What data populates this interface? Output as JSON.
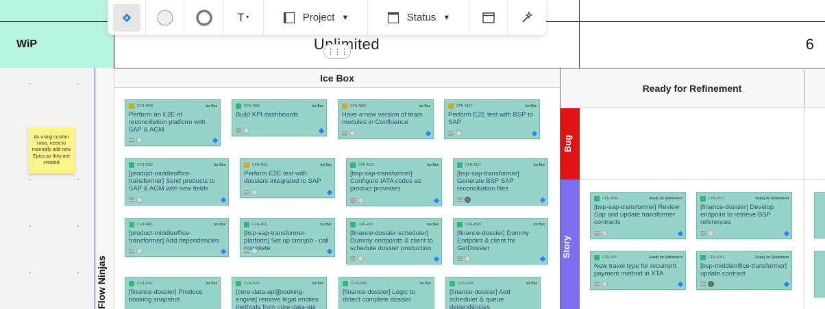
{
  "wip": {
    "label": "WiP",
    "value": "Unlimited",
    "value2": "6"
  },
  "toolbar": {
    "project_label": "Project",
    "status_label": "Status",
    "text_label": "T"
  },
  "sticky_note": "As using custom rows, need to manually add new Epics as they are created",
  "swimlane": {
    "name": "Flow Ninjas"
  },
  "icebox": {
    "title": "Ice Box",
    "cards": [
      {
        "key": "CFN-4946",
        "status": "Ice Box",
        "type": "task",
        "title": "Perform an E2E of reconciliation platform with SAP & AGM",
        "avatar": "empty"
      },
      {
        "key": "CFN-4289",
        "status": "Ice Box",
        "type": "story",
        "title": "Build KPI dashboards",
        "avatar": "empty"
      },
      {
        "key": "CFN-4806",
        "status": "Ice Box",
        "type": "task",
        "title": "Have a new version of team modules in Confluence",
        "avatar": "empty"
      },
      {
        "key": "CFN-4527",
        "status": "Ice Box",
        "type": "task",
        "title": "Perform E2E test with BSP to SAP",
        "avatar": "empty"
      },
      {
        "key": "CFN-4352",
        "status": "Ice Box",
        "type": "story",
        "title": "[product-middleoffice-transformer] Send products to SAP & AGM with new fields",
        "avatar": "empty"
      },
      {
        "key": "CFN-4561",
        "status": "Ice Box",
        "type": "task",
        "title": "Perform E2E test with dossiers integrated to SAP",
        "avatar": "empty"
      },
      {
        "key": "CFN-4319",
        "status": "Ice Box",
        "type": "story",
        "title": "[bsp-sap-transformer] Configure IATA codes as product providers",
        "avatar": "empty"
      },
      {
        "key": "CFN-4517",
        "status": "Ice Box",
        "type": "story",
        "title": "[bsp-sap-transformer] Generate BSP SAP reconciliation files",
        "avatar": "dark"
      },
      {
        "key": "CFN-4461",
        "status": "Ice Box",
        "type": "story",
        "title": "[product-middleoffice-transformer] Add dependencies",
        "avatar": "empty"
      },
      {
        "key": "CFN-4621",
        "status": "Ice Box",
        "type": "story",
        "title": "[bsp-sap-transformer-platform] Set up cronjob - call complete",
        "avatar": "empty"
      },
      {
        "key": "CFN-4591",
        "status": "Ice Box",
        "type": "story",
        "title": "[finance-dossier-scheduler] Dummy endpoints & client to schedule dossier production",
        "avatar": "empty"
      },
      {
        "key": "CFN-4590",
        "status": "Ice Box",
        "type": "story",
        "title": "[finance-dossier] Dummy Endpoint & client for GetDossier",
        "avatar": "empty"
      },
      {
        "key": "CFN-4547",
        "status": "Ice Box",
        "type": "story",
        "title": "[finance-dossier] Produce booking snapshot",
        "avatar": "empty"
      },
      {
        "key": "CFN-4543",
        "status": "Ice Box",
        "type": "story",
        "title": "[core-data-api][booking-engine] remove legal entities methods from core-data-api",
        "avatar": "empty"
      },
      {
        "key": "CFN-4558",
        "status": "Ice Box",
        "type": "story",
        "title": "[finance-dossier] Logic to detect complete dossier",
        "avatar": "empty"
      },
      {
        "key": "CFN-4548",
        "status": "Ice Box",
        "type": "story",
        "title": "[finance-dossier] Add scheduler & queue dependencies",
        "avatar": "empty"
      }
    ]
  },
  "ready": {
    "title": "Ready for Refinement",
    "bug_label": "Bug",
    "story_label": "Story",
    "cards": [
      {
        "key": "CFN-4556",
        "status": "Ready for Refinement",
        "type": "story",
        "title": "[bsp-sap-transformer] Review Sap and update transformer contracts",
        "avatar": "empty"
      },
      {
        "key": "CFN-4501",
        "status": "Ready for Refinement",
        "type": "story",
        "title": "[finance-dossier] Develop endpoint to retrieve BSP references",
        "avatar": "empty"
      },
      {
        "key": "CFN-5307",
        "status": "Ready for Refinement",
        "type": "story",
        "title": "New travel type for recurrent payment method in XTA",
        "avatar": "empty"
      },
      {
        "key": "CFN-5001",
        "status": "Ready for Refinement",
        "type": "story",
        "title": "[bsp-middleoffice-transformer] update contract",
        "avatar": "dark"
      }
    ]
  },
  "colors": {
    "card": "#96d4c9",
    "bug": "#e31313",
    "story": "#7b6ef0",
    "wip": "#b8f5e0",
    "story_icon": "#36b37e",
    "task_icon": "#d4a72c"
  }
}
